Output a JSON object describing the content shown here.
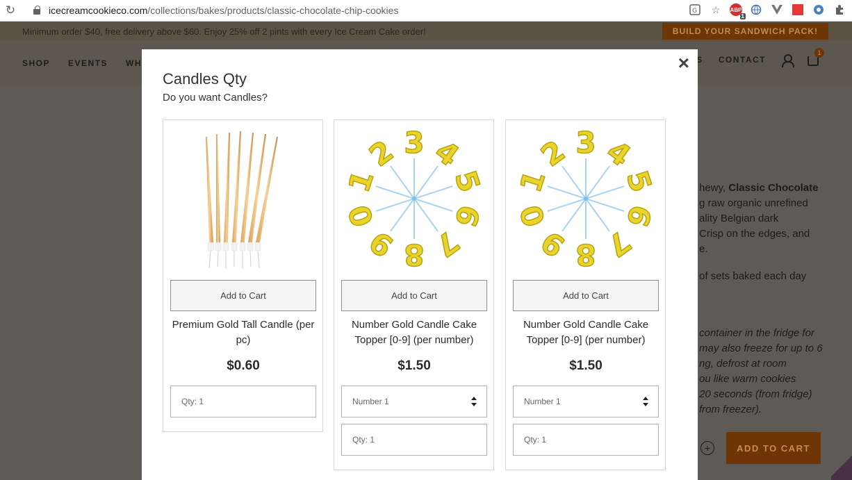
{
  "browser": {
    "url_host": "icecreamcookieco.com",
    "url_path": "/collections/bakes/products/classic-chocolate-chip-cookies",
    "abp_badge": "1"
  },
  "background": {
    "promo_text": "Minimum order $40, free delivery above $60. Enjoy 25% off 2 pints with every Ice Cream Cake order!",
    "promo_button": "BUILD YOUR SANDWICH PACK!",
    "nav": [
      "SHOP",
      "EVENTS",
      "WHO"
    ],
    "nav_contact": "CONTACT",
    "nav_partial": "S",
    "cart_count": "1",
    "desc_lines": [
      "hewy, ",
      "g raw organic unrefined",
      "ality Belgian dark",
      " Crisp on the edges, and",
      "e."
    ],
    "desc_bold": "Classic Chocolate",
    "sets_text": "of sets baked each day",
    "storage_lines": [
      "container in the fridge for",
      "may also freeze for up to 6",
      "ng, defrost at room",
      "ou like warm cookies",
      "20 seconds (from fridge)",
      "from freezer)."
    ],
    "qty_plus": "+",
    "add_to_cart": "ADD TO CART"
  },
  "modal": {
    "title": "Candles Qty",
    "subtitle": "Do you want Candles?",
    "close": "×",
    "products": [
      {
        "add_label": "Add to Cart",
        "name": "Premium Gold Tall Candle (per pc)",
        "price": "$0.60",
        "qty_placeholder": "Qty: 1"
      },
      {
        "add_label": "Add to Cart",
        "name": "Number Gold Candle Cake Topper [0-9] (per number)",
        "price": "$1.50",
        "number_select": "Number 1",
        "qty_placeholder": "Qty: 1"
      },
      {
        "add_label": "Add to Cart",
        "name": "Number Gold Candle Cake Topper [0-9] (per number)",
        "price": "$1.50",
        "number_select": "Number 1",
        "qty_placeholder": "Qty: 1"
      }
    ],
    "candle_digits": [
      "3",
      "4",
      "5",
      "6",
      "7",
      "8",
      "9",
      "0",
      "1",
      "2"
    ]
  }
}
